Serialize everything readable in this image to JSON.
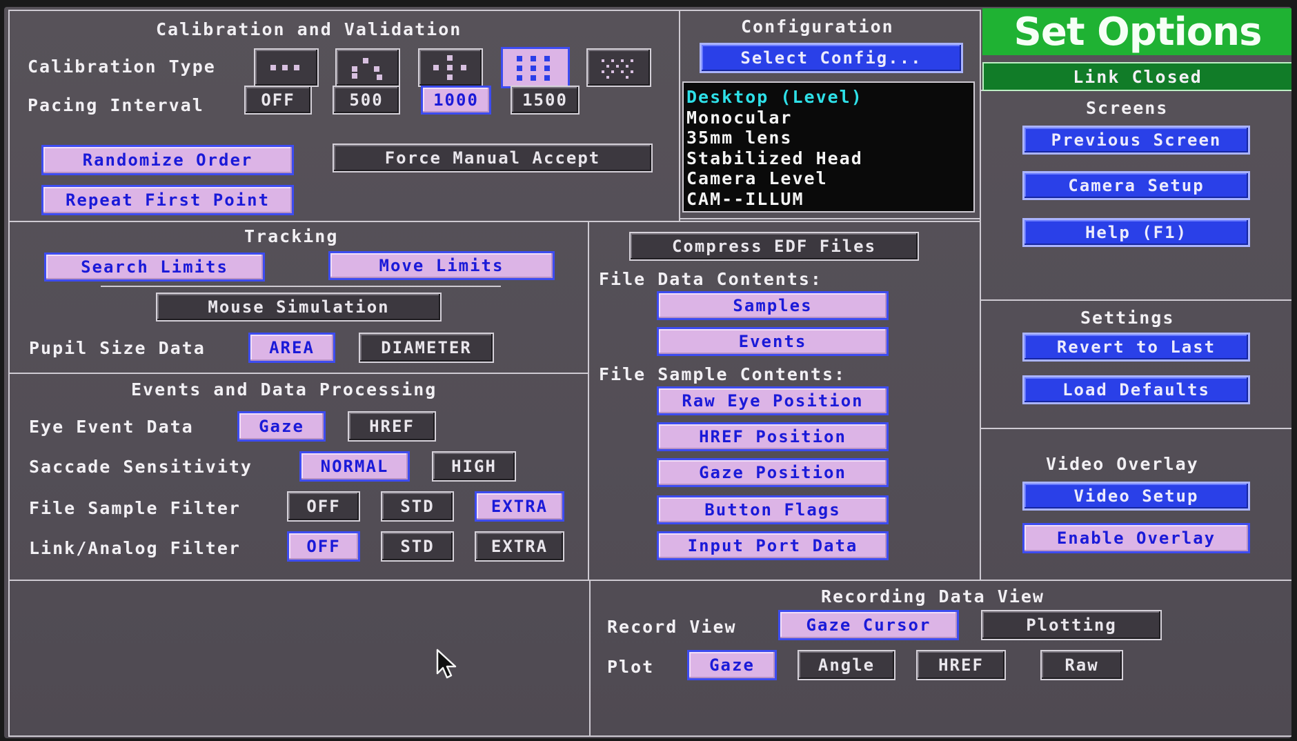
{
  "title": "Set Options",
  "status": "Link Closed",
  "calibration": {
    "heading": "Calibration and Validation",
    "type_label": "Calibration Type",
    "type_options": [
      {
        "name": "3-point",
        "selected": false
      },
      {
        "name": "5-point-alt",
        "selected": false
      },
      {
        "name": "5-point",
        "selected": false
      },
      {
        "name": "9-point",
        "selected": true
      },
      {
        "name": "13-point",
        "selected": false
      }
    ],
    "pacing_label": "Pacing Interval",
    "pacing_options": [
      "OFF",
      "500",
      "1000",
      "1500"
    ],
    "pacing_selected": "1000",
    "randomize": "Randomize Order",
    "force_manual": "Force Manual Accept",
    "repeat_first": "Repeat First Point"
  },
  "configuration": {
    "heading": "Configuration",
    "select_button": "Select Config...",
    "items": [
      "Desktop (Level)",
      "Monocular",
      "35mm lens",
      "Stabilized Head",
      "Camera Level",
      "CAM--ILLUM"
    ],
    "active_index": 0
  },
  "screens": {
    "heading": "Screens",
    "previous": "Previous Screen",
    "camera_setup": "Camera Setup",
    "help": "Help (F1)"
  },
  "settings": {
    "heading": "Settings",
    "revert": "Revert to Last",
    "defaults": "Load Defaults"
  },
  "video_overlay": {
    "heading": "Video Overlay",
    "setup": "Video Setup",
    "enable": "Enable Overlay"
  },
  "tracking": {
    "heading": "Tracking",
    "search_limits": "Search Limits",
    "move_limits": "Move Limits",
    "mouse_sim": "Mouse Simulation",
    "pupil_label": "Pupil Size Data",
    "pupil_options": [
      "AREA",
      "DIAMETER"
    ],
    "pupil_selected": "AREA"
  },
  "events": {
    "heading": "Events and Data Processing",
    "eye_event_label": "Eye Event Data",
    "eye_event_options": [
      "Gaze",
      "HREF"
    ],
    "eye_event_selected": "Gaze",
    "saccade_label": "Saccade Sensitivity",
    "saccade_options": [
      "NORMAL",
      "HIGH"
    ],
    "saccade_selected": "NORMAL",
    "file_filter_label": "File Sample Filter",
    "file_filter_options": [
      "OFF",
      "STD",
      "EXTRA"
    ],
    "file_filter_selected": "EXTRA",
    "link_filter_label": "Link/Analog Filter",
    "link_filter_options": [
      "OFF",
      "STD",
      "EXTRA"
    ],
    "link_filter_selected": "OFF"
  },
  "files": {
    "compress": "Compress EDF Files",
    "data_contents_label": "File Data Contents:",
    "data_contents": [
      "Samples",
      "Events"
    ],
    "sample_contents_label": "File Sample Contents:",
    "sample_contents": [
      "Raw Eye Position",
      "HREF Position",
      "Gaze Position",
      "Button Flags",
      "Input Port Data"
    ]
  },
  "recording": {
    "heading": "Recording Data View",
    "record_view_label": "Record View",
    "record_view_options": [
      "Gaze Cursor",
      "Plotting"
    ],
    "record_view_selected": "Gaze Cursor",
    "plot_label": "Plot",
    "plot_options": [
      "Gaze",
      "Angle",
      "HREF",
      "Raw"
    ],
    "plot_selected": "Gaze"
  },
  "colors": {
    "background": "#534e56",
    "button_on": "#dcb4e6",
    "button_blue": "#2a40e8",
    "title_green": "#1fb233",
    "status_green": "#117c28",
    "config_active": "#2ee0e8"
  }
}
